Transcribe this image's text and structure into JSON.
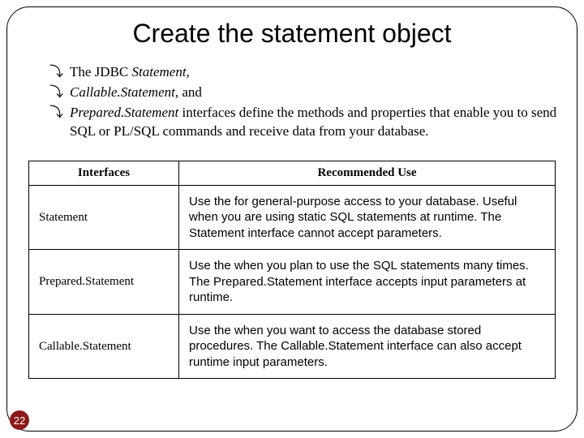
{
  "title": "Create the statement object",
  "bullets": {
    "b1_italic": "Statement,",
    "b1_prefix": "The JDBC ",
    "b2_italic": "Callable.Statement,",
    "b2_suffix": " and",
    "b3_italic": "Prepared.Statement",
    "b3_suffix": " interfaces define the methods and properties that enable you to send SQL or PL/SQL commands and receive data from your database."
  },
  "table": {
    "headers": {
      "h1": "Interfaces",
      "h2": "Recommended Use"
    },
    "rows": [
      {
        "name": "Statement",
        "desc": "Use the for general-purpose access to your database. Useful when you are using static SQL statements at runtime. The Statement interface cannot accept parameters."
      },
      {
        "name": "Prepared.Statement",
        "desc": "Use the when you plan to use the SQL statements many times. The Prepared.Statement interface accepts input parameters at runtime."
      },
      {
        "name": "Callable.Statement",
        "desc": "Use the when you want to access the database stored procedures. The Callable.Statement interface can also accept runtime input parameters."
      }
    ]
  },
  "page_number": "22"
}
